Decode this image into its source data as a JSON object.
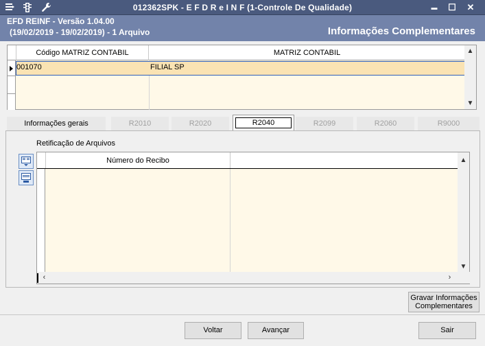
{
  "window": {
    "title": "012362SPK - E F D  R e I N F (1-Controle De Qualidade)",
    "icons": [
      "menu-icon",
      "traffic-light-icon",
      "wrench-icon"
    ],
    "controls": {
      "minimize": "▬",
      "maximize": "☐",
      "close": "✕"
    }
  },
  "header": {
    "line1": "EFD REINF - Versão 1.04.00",
    "line2": "(19/02/2019 - 19/02/2019) - 1 Arquivo",
    "section_title": "Informações Complementares"
  },
  "matrix_grid": {
    "columns": [
      "Código MATRIZ CONTABIL",
      "MATRIZ CONTABIL"
    ],
    "rows": [
      {
        "codigo": "001070",
        "matriz": "FILIAL SP"
      }
    ]
  },
  "tabs": [
    {
      "label": "Informações gerais",
      "state": "enabled"
    },
    {
      "label": "R2010",
      "state": "disabled"
    },
    {
      "label": "R2020",
      "state": "disabled"
    },
    {
      "label": "R2040",
      "state": "active"
    },
    {
      "label": "R2099",
      "state": "disabled"
    },
    {
      "label": "R2060",
      "state": "disabled"
    },
    {
      "label": "R9000",
      "state": "disabled"
    }
  ],
  "retificacao": {
    "label": "Retificação de Arquivos",
    "columns": [
      "Número do Recibo",
      ""
    ],
    "rows": []
  },
  "buttons": {
    "gravar_line1": "Gravar Informações",
    "gravar_line2": "Complementares",
    "voltar": "Voltar",
    "avancar": "Avançar",
    "sair": "Sair"
  }
}
